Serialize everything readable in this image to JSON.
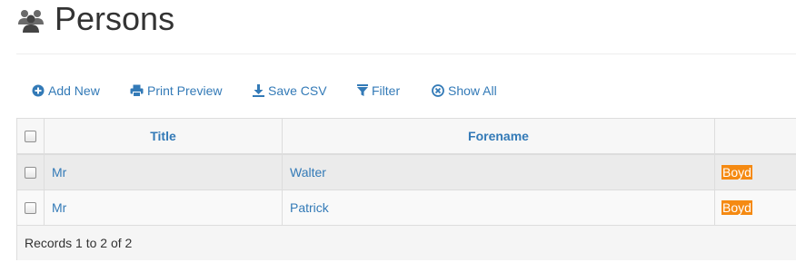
{
  "header": {
    "title": "Persons",
    "icon": "users-icon"
  },
  "toolbar": {
    "add_new": "Add New",
    "print_preview": "Print Preview",
    "save_csv": "Save CSV",
    "filter": "Filter",
    "show_all": "Show All"
  },
  "table": {
    "columns": [
      "Title",
      "Forename",
      ""
    ],
    "rows": [
      {
        "title": "Mr",
        "forename": "Walter",
        "surname": "Boyd"
      },
      {
        "title": "Mr",
        "forename": "Patrick",
        "surname": "Boyd"
      }
    ],
    "footer": "Records 1 to 2 of 2"
  },
  "colors": {
    "link": "#337ab7",
    "highlight": "#f58a12"
  }
}
